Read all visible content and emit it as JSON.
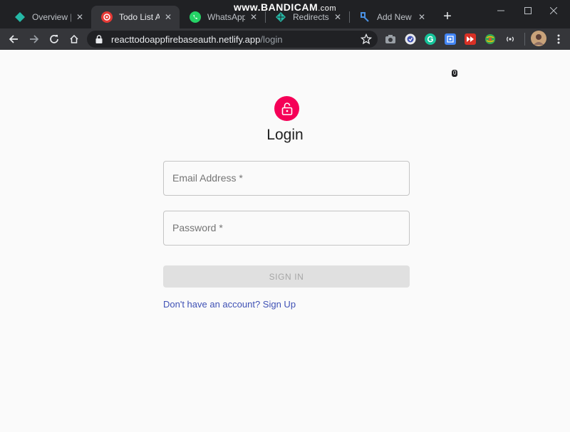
{
  "watermark": {
    "main": "www.BANDICAM",
    "suffix": ".com"
  },
  "browser": {
    "tabs": [
      {
        "title": "Overview | react",
        "icon": "netlify-icon"
      },
      {
        "title": "Todo List App",
        "icon": "react-icon"
      },
      {
        "title": "WhatsApp",
        "icon": "whatsapp-icon"
      },
      {
        "title": "Redirects and",
        "icon": "netlify-icon"
      },
      {
        "title": "Add New Post",
        "icon": "wordpress-icon"
      }
    ],
    "active_tab_index": 1,
    "url_host": "reacttodoappfirebaseauth.netlify.app",
    "url_path": "/login",
    "extensions": [
      "camera-icon",
      "vpn-icon",
      "grammarly-icon",
      "puzzle-icon",
      "video-speed-icon",
      "globe-icon",
      "broadcast-icon",
      "avatar-icon"
    ],
    "extension_badge": "0",
    "colors": {
      "tabstrip": "#202124",
      "toolbar": "#35363a"
    }
  },
  "login": {
    "icon": "lock-open-icon",
    "title": "Login",
    "email_placeholder": "Email Address *",
    "password_placeholder": "Password *",
    "submit_label": "SIGN IN",
    "signup_link": "Don't have an account? Sign Up",
    "colors": {
      "avatar": "#f50057",
      "link": "#3f51b5",
      "button_disabled": "#e0e0e0"
    }
  }
}
